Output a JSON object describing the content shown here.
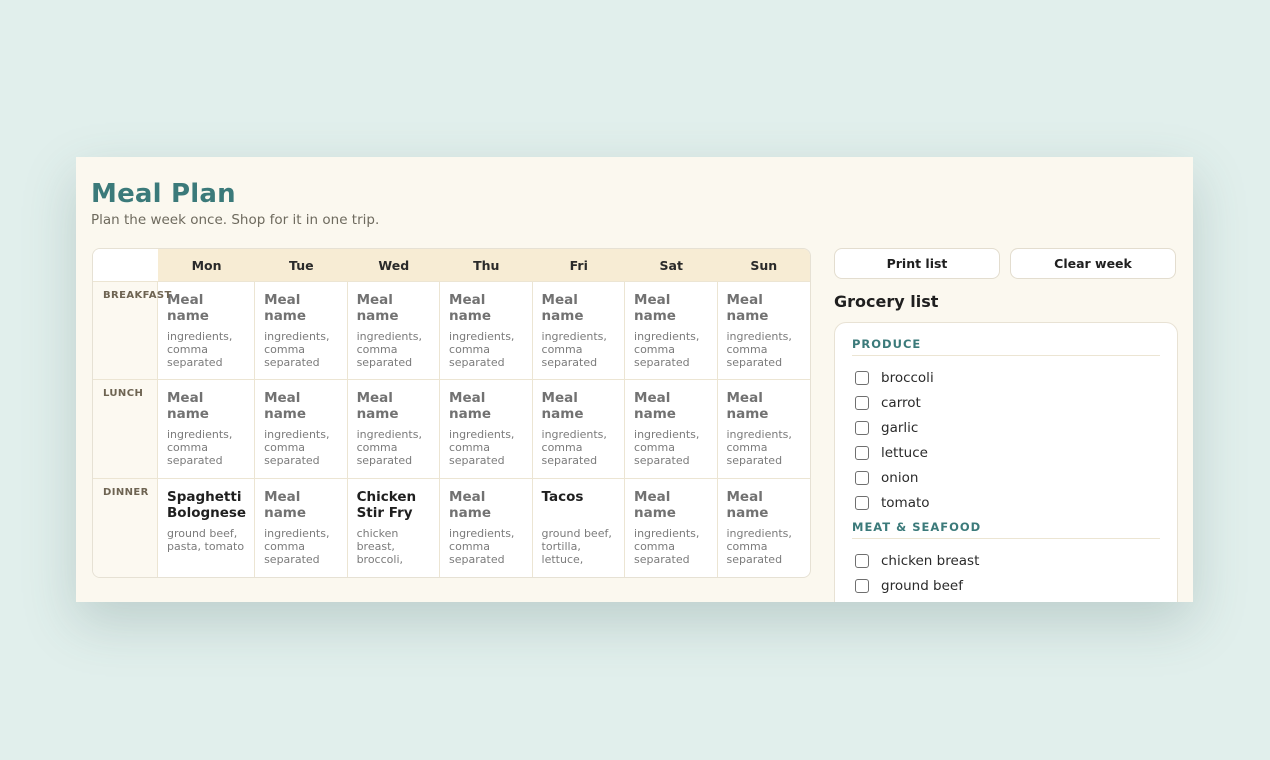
{
  "header": {
    "title": "Meal Plan",
    "subtitle": "Plan the week once. Shop for it in one trip."
  },
  "week": {
    "days": [
      "Mon",
      "Tue",
      "Wed",
      "Thu",
      "Fri",
      "Sat",
      "Sun"
    ],
    "meals": [
      {
        "label": "BREAKFAST",
        "cells": [
          {
            "name": "Meal name",
            "ingredients": "ingredients, comma separated",
            "filled": false
          },
          {
            "name": "Meal name",
            "ingredients": "ingredients, comma separated",
            "filled": false
          },
          {
            "name": "Meal name",
            "ingredients": "ingredients, comma separated",
            "filled": false
          },
          {
            "name": "Meal name",
            "ingredients": "ingredients, comma separated",
            "filled": false
          },
          {
            "name": "Meal name",
            "ingredients": "ingredients, comma separated",
            "filled": false
          },
          {
            "name": "Meal name",
            "ingredients": "ingredients, comma separated",
            "filled": false
          },
          {
            "name": "Meal name",
            "ingredients": "ingredients, comma separated",
            "filled": false
          }
        ]
      },
      {
        "label": "LUNCH",
        "cells": [
          {
            "name": "Meal name",
            "ingredients": "ingredients, comma separated",
            "filled": false
          },
          {
            "name": "Meal name",
            "ingredients": "ingredients, comma separated",
            "filled": false
          },
          {
            "name": "Meal name",
            "ingredients": "ingredients, comma separated",
            "filled": false
          },
          {
            "name": "Meal name",
            "ingredients": "ingredients, comma separated",
            "filled": false
          },
          {
            "name": "Meal name",
            "ingredients": "ingredients, comma separated",
            "filled": false
          },
          {
            "name": "Meal name",
            "ingredients": "ingredients, comma separated",
            "filled": false
          },
          {
            "name": "Meal name",
            "ingredients": "ingredients, comma separated",
            "filled": false
          }
        ]
      },
      {
        "label": "DINNER",
        "cells": [
          {
            "name": "Spaghetti Bolognese",
            "ingredients": "ground beef, pasta, tomato",
            "filled": true
          },
          {
            "name": "Meal name",
            "ingredients": "ingredients, comma separated",
            "filled": false
          },
          {
            "name": "Chicken Stir Fry",
            "ingredients": "chicken breast, broccoli,",
            "filled": true
          },
          {
            "name": "Meal name",
            "ingredients": "ingredients, comma separated",
            "filled": false
          },
          {
            "name": "Tacos",
            "ingredients": "ground beef, tortilla, lettuce,",
            "filled": true
          },
          {
            "name": "Meal name",
            "ingredients": "ingredients, comma separated",
            "filled": false
          },
          {
            "name": "Meal name",
            "ingredients": "ingredients, comma separated",
            "filled": false
          }
        ]
      }
    ]
  },
  "actions": {
    "print_label": "Print list",
    "clear_label": "Clear week"
  },
  "grocery": {
    "title": "Grocery list",
    "categories": [
      {
        "name": "PRODUCE",
        "items": [
          "broccoli",
          "carrot",
          "garlic",
          "lettuce",
          "onion",
          "tomato"
        ]
      },
      {
        "name": "MEAT & SEAFOOD",
        "items": [
          "chicken breast",
          "ground beef"
        ]
      }
    ]
  },
  "colors": {
    "background": "#e1efec",
    "panel": "#fbf8ef",
    "accent": "#3b7a7a",
    "header_band": "#f7ecd4"
  }
}
